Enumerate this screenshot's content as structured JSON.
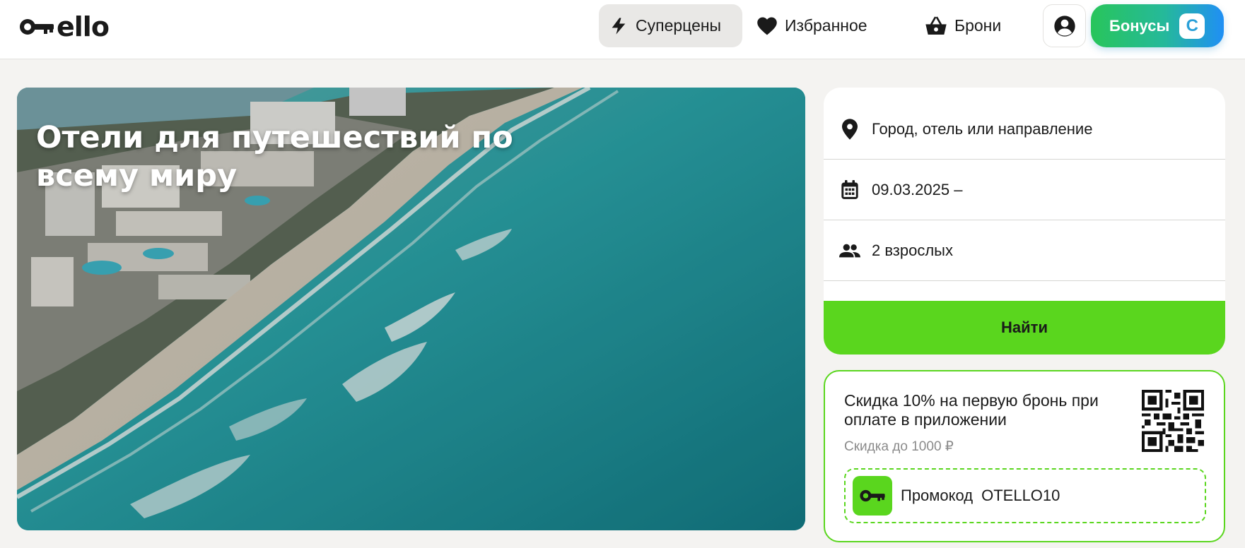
{
  "header": {
    "logo_text": "ello",
    "nav": {
      "superprices": "Суперцены",
      "favorites": "Избранное",
      "bookings": "Брони"
    },
    "bonus_label": "Бонусы",
    "bonus_coin": "С"
  },
  "hero": {
    "title": "Отели для путешествий по всему миру"
  },
  "search": {
    "destination_placeholder": "Город, отель или направление",
    "dates": "09.03.2025 –",
    "guests": "2 взрослых",
    "find_label": "Найти"
  },
  "promo": {
    "title": "Скидка 10% на первую бронь при оплате в приложении",
    "subtitle": "Скидка до 1000 ₽",
    "code_label": "Промокод",
    "code_value": "OTELLO10"
  },
  "colors": {
    "accent_green": "#5ad61e",
    "bonus_gradient_start": "#28c55b",
    "bonus_gradient_end": "#1f8ff5"
  }
}
